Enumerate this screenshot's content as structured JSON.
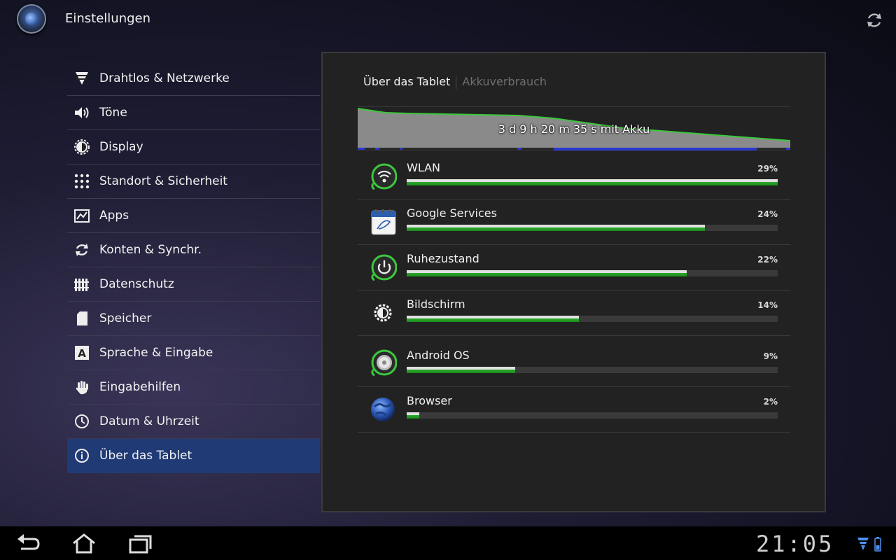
{
  "header": {
    "title": "Einstellungen"
  },
  "menu": {
    "items": [
      {
        "label": "Drahtlos & Netzwerke",
        "icon": "wifi-icon"
      },
      {
        "label": "Töne",
        "icon": "speaker-icon"
      },
      {
        "label": "Display",
        "icon": "brightness-icon"
      },
      {
        "label": "Standort & Sicherheit",
        "icon": "location-grid-icon"
      },
      {
        "label": "Apps",
        "icon": "apps-icon"
      },
      {
        "label": "Konten & Synchr.",
        "icon": "sync-icon"
      },
      {
        "label": "Datenschutz",
        "icon": "fence-icon"
      },
      {
        "label": "Speicher",
        "icon": "sdcard-icon"
      },
      {
        "label": "Sprache & Eingabe",
        "icon": "keyboard-a-icon"
      },
      {
        "label": "Eingabehilfen",
        "icon": "hand-icon"
      },
      {
        "label": "Datum & Uhrzeit",
        "icon": "clock-icon"
      },
      {
        "label": "Über das Tablet",
        "icon": "info-icon"
      }
    ],
    "active_index": 11
  },
  "panel": {
    "breadcrumb_current": "Über das Tablet",
    "breadcrumb_page": "Akkuverbrauch",
    "battery_time": "3 d 9 h 20 m 35 s mit Akku",
    "usage": [
      {
        "name": "WLAN",
        "percent_label": "29%",
        "fill": 1.0,
        "icon": "wifi-icon"
      },
      {
        "name": "Google Services",
        "percent_label": "24%",
        "fill": 0.804,
        "icon": "calendar-icon"
      },
      {
        "name": "Ruhezustand",
        "percent_label": "22%",
        "fill": 0.755,
        "icon": "power-icon"
      },
      {
        "name": "Bildschirm",
        "percent_label": "14%",
        "fill": 0.465,
        "icon": "brightness-icon"
      },
      {
        "name": "Android OS",
        "percent_label": "9%",
        "fill": 0.293,
        "icon": "android-os-icon"
      },
      {
        "name": "Browser",
        "percent_label": "2%",
        "fill": 0.034,
        "icon": "globe-icon"
      }
    ]
  },
  "status": {
    "time": "21:05"
  },
  "colors": {
    "accent": "#203a76",
    "bar_green": "#2eaa2e"
  }
}
